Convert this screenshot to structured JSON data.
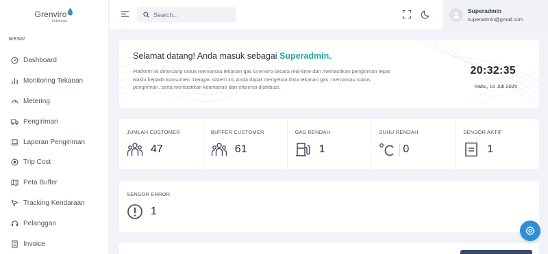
{
  "brand": {
    "name": "Grenviro",
    "sub": "Indonesia"
  },
  "sidebar": {
    "menu_title": "MENU",
    "items": [
      {
        "label": "Dashboard",
        "icon": "dashboard-icon"
      },
      {
        "label": "Monitoring Tekanan",
        "icon": "bar-chart-icon"
      },
      {
        "label": "Metering",
        "icon": "gauge-icon"
      },
      {
        "label": "Pengiriman",
        "icon": "truck-icon"
      },
      {
        "label": "Laporan Pengiriman",
        "icon": "laptop-icon"
      },
      {
        "label": "Trip Cost",
        "icon": "record-icon"
      },
      {
        "label": "Peta Buffer",
        "icon": "map-icon"
      },
      {
        "label": "Tracking Kendaraan",
        "icon": "cursor-icon"
      },
      {
        "label": "Pelanggan",
        "icon": "headset-icon"
      },
      {
        "label": "Invoice",
        "icon": "document-icon"
      }
    ]
  },
  "header": {
    "search_placeholder": "Search...",
    "user": {
      "name": "Superadmin",
      "email": "superadmin@gmail.com"
    }
  },
  "welcome": {
    "title_prefix": "Selamat datang! Anda masuk sebagai ",
    "title_role": "Superadmin.",
    "description": "Platform ini dirancang untuk memantau tekanan gas Grenviro secara real-time dan memastikan pengiriman tepat waktu kepada konsumen. Dengan sistem ini, Anda dapat mengelola data tekanan gas, memantau status pengiriman, serta memastikan keamanan dan efisiensi distribusi.",
    "time": "20:32:35",
    "date": "Rabu, 16 Juli 2025"
  },
  "stats": [
    {
      "label": "JUMLAH CUSTOMER",
      "value": "47",
      "icon": "users-icon"
    },
    {
      "label": "BUFFER CUSTOMER",
      "value": "61",
      "icon": "users-icon"
    },
    {
      "label": "GAS RENDAH",
      "value": "1",
      "icon": "gas-station-icon"
    },
    {
      "label": "SUHU RENDAH",
      "value": "0",
      "icon": "celsius-icon"
    },
    {
      "label": "SENSOR AKTIF",
      "value": "1",
      "icon": "sensor-icon"
    }
  ],
  "sensor_error": {
    "label": "SENSOR ERROR",
    "value": "1",
    "icon": "alert-circle-icon"
  },
  "colors": {
    "accent": "#2aa89a",
    "fab": "#2f8fd6",
    "background": "#f2f3f8"
  }
}
